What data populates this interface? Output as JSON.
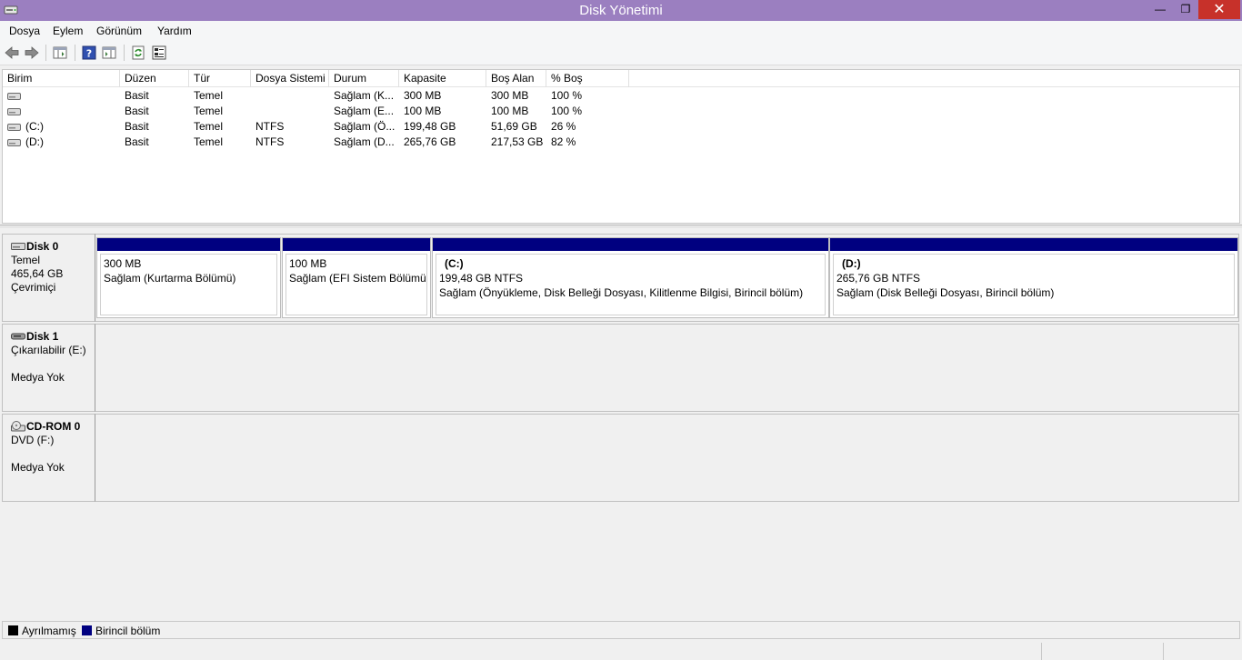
{
  "window": {
    "title": "Disk Yönetimi",
    "title_bar_color": "#9b7fc0",
    "minimize_symbol": "—",
    "maximize_symbol": "❐",
    "close_symbol": "✕"
  },
  "menu": {
    "items": [
      "Dosya",
      "Eylem",
      "Görünüm",
      "Yardım"
    ]
  },
  "toolbar": {
    "icons": [
      "back-arrow-icon",
      "forward-arrow-icon",
      "show-hide-console-tree-icon",
      "help-icon",
      "show-hide-action-pane-icon",
      "refresh-icon",
      "properties-icon"
    ]
  },
  "volume_list": {
    "columns": [
      "Birim",
      "Düzen",
      "Tür",
      "Dosya Sistemi",
      "Durum",
      "Kapasite",
      "Boş Alan",
      "% Boş"
    ],
    "rows": [
      [
        "",
        "Basit",
        "Temel",
        "",
        "Sağlam (K...",
        "300 MB",
        "300 MB",
        "100 %"
      ],
      [
        "",
        "Basit",
        "Temel",
        "",
        "Sağlam (E...",
        "100 MB",
        "100 MB",
        "100 %"
      ],
      [
        "(C:)",
        "Basit",
        "Temel",
        "NTFS",
        "Sağlam (Ö...",
        "199,48 GB",
        "51,69 GB",
        "26 %"
      ],
      [
        "(D:)",
        "Basit",
        "Temel",
        "NTFS",
        "Sağlam (D...",
        "265,76 GB",
        "217,53 GB",
        "82 %"
      ]
    ]
  },
  "disks": [
    {
      "name": "Disk 0",
      "type": "Temel",
      "size": "465,64 GB",
      "status": "Çevrimiçi",
      "partitions": [
        {
          "name": "",
          "size": "300 MB",
          "status": "Sağlam (Kurtarma Bölümü)"
        },
        {
          "name": "",
          "size": "100 MB",
          "status": "Sağlam (EFI Sistem Bölümü)"
        },
        {
          "name": "(C:)",
          "size": "199,48 GB NTFS",
          "status": "Sağlam (Önyükleme, Disk Belleği Dosyası, Kilitlenme Bilgisi, Birincil bölüm)"
        },
        {
          "name": "(D:)",
          "size": "265,76 GB NTFS",
          "status": "Sağlam (Disk Belleği Dosyası, Birincil bölüm)"
        }
      ]
    },
    {
      "name": "Disk 1",
      "type": "Çıkarılabilir (E:)",
      "status": "Medya Yok"
    },
    {
      "name": "CD-ROM 0",
      "type": "DVD (F:)",
      "status": "Medya Yok"
    }
  ],
  "legend": [
    {
      "label": "Ayrılmamış",
      "color": "#000000"
    },
    {
      "label": "Birincil bölüm",
      "color": "#000080"
    }
  ]
}
